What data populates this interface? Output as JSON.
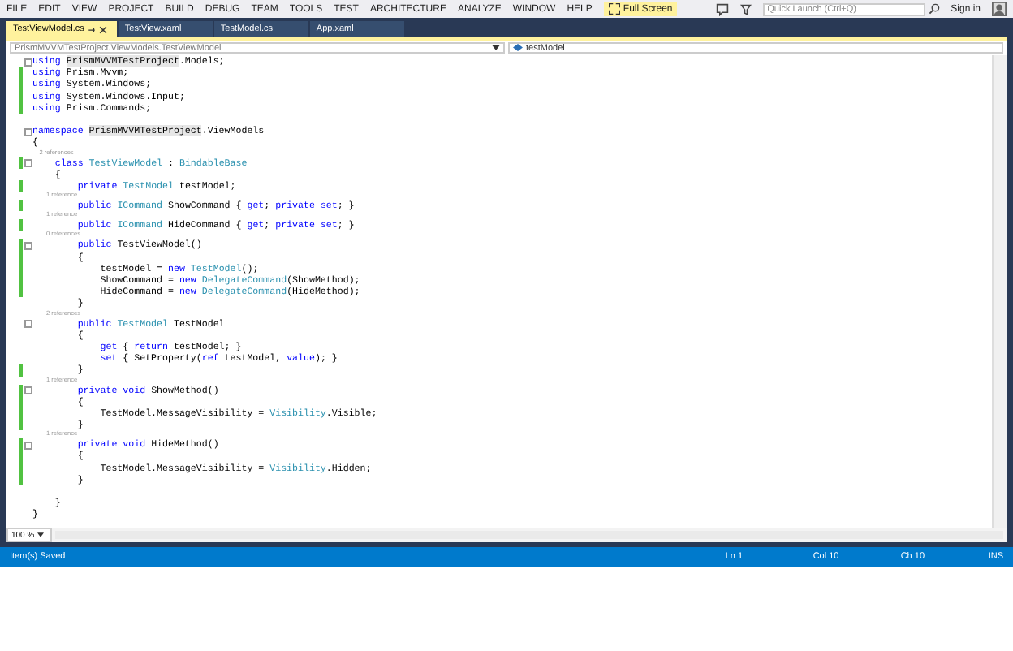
{
  "menu": {
    "items": [
      "FILE",
      "EDIT",
      "VIEW",
      "PROJECT",
      "BUILD",
      "DEBUG",
      "TEAM",
      "TOOLS",
      "TEST",
      "ARCHITECTURE",
      "ANALYZE",
      "WINDOW",
      "HELP"
    ],
    "full_screen": "Full Screen",
    "quick_launch": {
      "placeholder": "Quick Launch (Ctrl+Q)"
    },
    "sign_in": "Sign in"
  },
  "tabs": [
    {
      "label": "TestViewModel.cs",
      "selected": true
    },
    {
      "label": "TestView.xaml",
      "selected": false
    },
    {
      "label": "TestModel.cs",
      "selected": false
    },
    {
      "label": "App.xaml",
      "selected": false
    }
  ],
  "navigation": {
    "scope": "PrismMVVMTestProject.ViewModels.TestViewModel",
    "member": "testModel"
  },
  "editor": {
    "lines": [
      {
        "kind": "code",
        "fold": true,
        "changed": false,
        "parts": [
          {
            "text": "using ",
            "kind": "keyword"
          },
          {
            "text": "PrismMVVMTestProject",
            "kind": "highlight"
          },
          {
            "text": ".Models;",
            "kind": "plain"
          }
        ]
      },
      {
        "kind": "code",
        "fold": false,
        "changed": true,
        "parts": [
          {
            "text": "using ",
            "kind": "keyword"
          },
          {
            "text": "Prism.Mvvm;",
            "kind": "plain"
          }
        ]
      },
      {
        "kind": "code",
        "fold": false,
        "changed": true,
        "parts": [
          {
            "text": "using ",
            "kind": "keyword"
          },
          {
            "text": "System.Windows;",
            "kind": "plain"
          }
        ]
      },
      {
        "kind": "code",
        "fold": false,
        "changed": true,
        "parts": [
          {
            "text": "using ",
            "kind": "keyword"
          },
          {
            "text": "System.Windows.Input;",
            "kind": "plain"
          }
        ]
      },
      {
        "kind": "code",
        "fold": false,
        "changed": true,
        "parts": [
          {
            "text": "using ",
            "kind": "keyword"
          },
          {
            "text": "Prism.Commands;",
            "kind": "plain"
          }
        ]
      },
      {
        "kind": "blank",
        "fold": false,
        "changed": false
      },
      {
        "kind": "code",
        "fold": true,
        "changed": false,
        "parts": [
          {
            "text": "namespace ",
            "kind": "keyword"
          },
          {
            "text": "PrismMVVMTestProject",
            "kind": "highlight"
          },
          {
            "text": ".ViewModels",
            "kind": "plain"
          }
        ]
      },
      {
        "kind": "code",
        "fold": false,
        "changed": false,
        "parts": [
          {
            "text": "{",
            "kind": "plain"
          }
        ]
      },
      {
        "kind": "lens",
        "text": "    2 references"
      },
      {
        "kind": "code",
        "fold": true,
        "changed": true,
        "parts": [
          {
            "text": "    class ",
            "kind": "keyword"
          },
          {
            "text": "TestViewModel",
            "kind": "type"
          },
          {
            "text": " : ",
            "kind": "plain"
          },
          {
            "text": "BindableBase",
            "kind": "type"
          }
        ]
      },
      {
        "kind": "code",
        "fold": false,
        "changed": false,
        "parts": [
          {
            "text": "    {",
            "kind": "plain"
          }
        ]
      },
      {
        "kind": "code",
        "fold": false,
        "changed": true,
        "parts": [
          {
            "text": "        private ",
            "kind": "keyword"
          },
          {
            "text": "TestModel",
            "kind": "type"
          },
          {
            "text": " testModel;",
            "kind": "plain"
          }
        ]
      },
      {
        "kind": "lens",
        "text": "        1 reference"
      },
      {
        "kind": "code",
        "fold": false,
        "changed": true,
        "parts": [
          {
            "text": "        public ",
            "kind": "keyword"
          },
          {
            "text": "ICommand",
            "kind": "type"
          },
          {
            "text": " ShowCommand { ",
            "kind": "plain"
          },
          {
            "text": "get",
            "kind": "keyword"
          },
          {
            "text": "; ",
            "kind": "plain"
          },
          {
            "text": "private set",
            "kind": "keyword"
          },
          {
            "text": "; }",
            "kind": "plain"
          }
        ]
      },
      {
        "kind": "lens",
        "text": "        1 reference"
      },
      {
        "kind": "code",
        "fold": false,
        "changed": true,
        "parts": [
          {
            "text": "        public ",
            "kind": "keyword"
          },
          {
            "text": "ICommand",
            "kind": "type"
          },
          {
            "text": " HideCommand { ",
            "kind": "plain"
          },
          {
            "text": "get",
            "kind": "keyword"
          },
          {
            "text": "; ",
            "kind": "plain"
          },
          {
            "text": "private set",
            "kind": "keyword"
          },
          {
            "text": "; }",
            "kind": "plain"
          }
        ]
      },
      {
        "kind": "lens",
        "text": "        0 references"
      },
      {
        "kind": "code",
        "fold": true,
        "changed": true,
        "parts": [
          {
            "text": "        public ",
            "kind": "keyword"
          },
          {
            "text": "TestViewModel()",
            "kind": "plain"
          }
        ]
      },
      {
        "kind": "code",
        "fold": false,
        "changed": true,
        "parts": [
          {
            "text": "        {",
            "kind": "plain"
          }
        ]
      },
      {
        "kind": "code",
        "fold": false,
        "changed": true,
        "parts": [
          {
            "text": "            testModel = ",
            "kind": "plain"
          },
          {
            "text": "new ",
            "kind": "keyword"
          },
          {
            "text": "TestModel",
            "kind": "type"
          },
          {
            "text": "();",
            "kind": "plain"
          }
        ]
      },
      {
        "kind": "code",
        "fold": false,
        "changed": true,
        "parts": [
          {
            "text": "            ShowCommand = ",
            "kind": "plain"
          },
          {
            "text": "new ",
            "kind": "keyword"
          },
          {
            "text": "DelegateCommand",
            "kind": "type"
          },
          {
            "text": "(ShowMethod);",
            "kind": "plain"
          }
        ]
      },
      {
        "kind": "code",
        "fold": false,
        "changed": true,
        "parts": [
          {
            "text": "            HideCommand = ",
            "kind": "plain"
          },
          {
            "text": "new ",
            "kind": "keyword"
          },
          {
            "text": "DelegateCommand",
            "kind": "type"
          },
          {
            "text": "(HideMethod);",
            "kind": "plain"
          }
        ]
      },
      {
        "kind": "code",
        "fold": false,
        "changed": false,
        "parts": [
          {
            "text": "        }",
            "kind": "plain"
          }
        ]
      },
      {
        "kind": "lens",
        "text": "        2 references"
      },
      {
        "kind": "code",
        "fold": true,
        "changed": false,
        "parts": [
          {
            "text": "        public ",
            "kind": "keyword"
          },
          {
            "text": "TestModel",
            "kind": "type"
          },
          {
            "text": " TestModel",
            "kind": "plain"
          }
        ]
      },
      {
        "kind": "code",
        "fold": false,
        "changed": false,
        "parts": [
          {
            "text": "        {",
            "kind": "plain"
          }
        ]
      },
      {
        "kind": "code",
        "fold": false,
        "changed": false,
        "parts": [
          {
            "text": "            get",
            "kind": "keyword"
          },
          {
            "text": " { ",
            "kind": "plain"
          },
          {
            "text": "return",
            "kind": "keyword"
          },
          {
            "text": " testModel; }",
            "kind": "plain"
          }
        ]
      },
      {
        "kind": "code",
        "fold": false,
        "changed": false,
        "parts": [
          {
            "text": "            set",
            "kind": "keyword"
          },
          {
            "text": " { SetProperty(",
            "kind": "plain"
          },
          {
            "text": "ref",
            "kind": "keyword"
          },
          {
            "text": " testModel, ",
            "kind": "plain"
          },
          {
            "text": "value",
            "kind": "keyword"
          },
          {
            "text": "); }",
            "kind": "plain"
          }
        ]
      },
      {
        "kind": "code",
        "fold": false,
        "changed": true,
        "parts": [
          {
            "text": "        }",
            "kind": "plain"
          }
        ]
      },
      {
        "kind": "lens",
        "text": "        1 reference"
      },
      {
        "kind": "code",
        "fold": true,
        "changed": true,
        "parts": [
          {
            "text": "        private void ",
            "kind": "keyword"
          },
          {
            "text": "ShowMethod()",
            "kind": "plain"
          }
        ]
      },
      {
        "kind": "code",
        "fold": false,
        "changed": true,
        "parts": [
          {
            "text": "        {",
            "kind": "plain"
          }
        ]
      },
      {
        "kind": "code",
        "fold": false,
        "changed": true,
        "parts": [
          {
            "text": "            TestModel.MessageVisibility = ",
            "kind": "plain"
          },
          {
            "text": "Visibility",
            "kind": "type"
          },
          {
            "text": ".Visible;",
            "kind": "plain"
          }
        ]
      },
      {
        "kind": "code",
        "fold": false,
        "changed": true,
        "parts": [
          {
            "text": "        }",
            "kind": "plain"
          }
        ]
      },
      {
        "kind": "lens",
        "text": "        1 reference"
      },
      {
        "kind": "code",
        "fold": true,
        "changed": true,
        "parts": [
          {
            "text": "        private void ",
            "kind": "keyword"
          },
          {
            "text": "HideMethod()",
            "kind": "plain"
          }
        ]
      },
      {
        "kind": "code",
        "fold": false,
        "changed": true,
        "parts": [
          {
            "text": "        {",
            "kind": "plain"
          }
        ]
      },
      {
        "kind": "code",
        "fold": false,
        "changed": true,
        "parts": [
          {
            "text": "            TestModel.MessageVisibility = ",
            "kind": "plain"
          },
          {
            "text": "Visibility",
            "kind": "type"
          },
          {
            "text": ".Hidden;",
            "kind": "plain"
          }
        ]
      },
      {
        "kind": "code",
        "fold": false,
        "changed": true,
        "parts": [
          {
            "text": "        }",
            "kind": "plain"
          }
        ]
      },
      {
        "kind": "blank",
        "fold": false,
        "changed": false
      },
      {
        "kind": "code",
        "fold": false,
        "changed": false,
        "parts": [
          {
            "text": "    }",
            "kind": "plain"
          }
        ]
      },
      {
        "kind": "code",
        "fold": false,
        "changed": false,
        "parts": [
          {
            "text": "}",
            "kind": "plain"
          }
        ]
      }
    ],
    "zoom": "100 %"
  },
  "status_bar": {
    "message": "Item(s) Saved",
    "line": "Ln 1",
    "column": "Col 10",
    "char": "Ch 10",
    "mode": "INS"
  }
}
